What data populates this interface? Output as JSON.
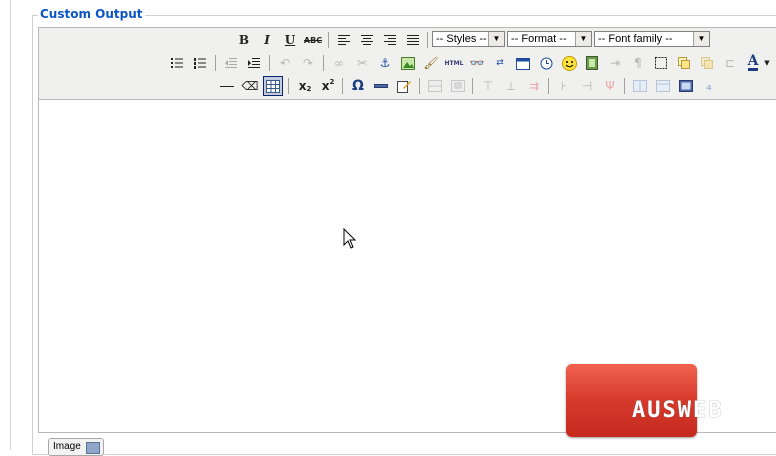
{
  "fieldset": {
    "legend": "Custom Output"
  },
  "toolbar": {
    "row1": {
      "bold": "B",
      "italic": "I",
      "underline": "U",
      "strike": "ABC",
      "styles": "-- Styles --",
      "format": "-- Format --",
      "font_family": "-- Font family --"
    },
    "row2": {
      "html": "HTML",
      "font_color": "A"
    },
    "row3": {
      "subscript_x": "x",
      "subscript_2": "2",
      "superscript_x": "x",
      "superscript_2": "2",
      "omega": "Ω"
    }
  },
  "watermark": {
    "text": "AUSWEB"
  },
  "image_button": {
    "label": "Image"
  }
}
